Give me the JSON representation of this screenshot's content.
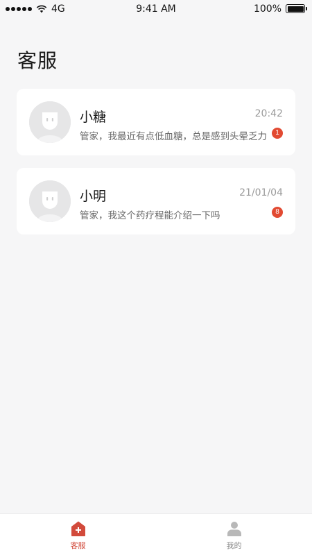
{
  "status_bar": {
    "carrier": "4G",
    "time": "9:41 AM",
    "battery": "100%"
  },
  "page": {
    "title": "客服"
  },
  "chats": [
    {
      "name": "小糖",
      "time": "20:42",
      "preview": "管家，我最近有点低血糖，总是感到头晕乏力",
      "unread": "1"
    },
    {
      "name": "小明",
      "time": "21/01/04",
      "preview": "管家，我这个药疗程能介绍一下吗",
      "unread": "8"
    }
  ],
  "tab_bar": {
    "items": [
      {
        "label": "客服",
        "icon": "service-house-icon",
        "active": true
      },
      {
        "label": "我的",
        "icon": "person-icon",
        "active": false
      }
    ]
  },
  "colors": {
    "accent": "#d24a3b",
    "badge": "#e24a32",
    "background": "#f6f6f7"
  }
}
